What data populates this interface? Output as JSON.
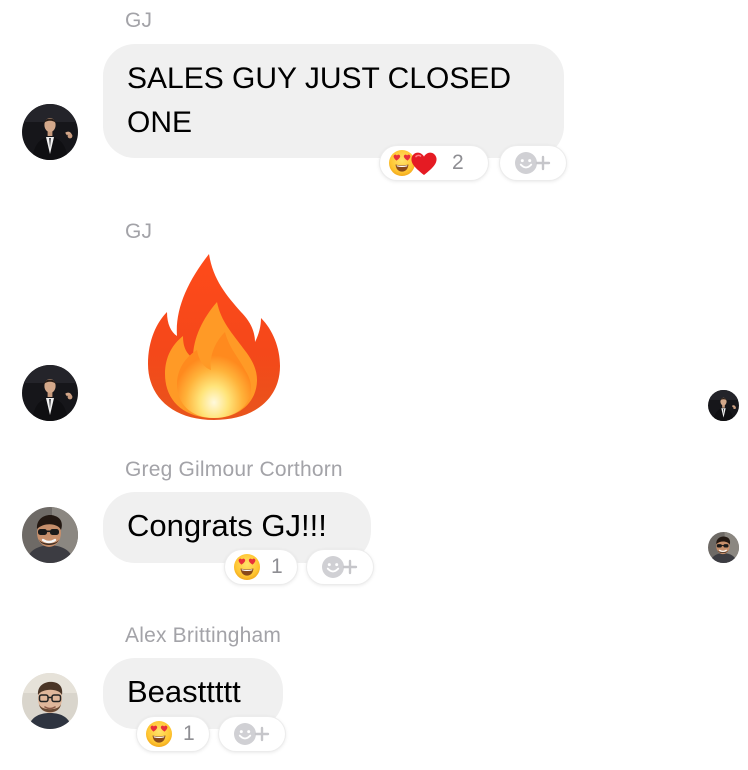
{
  "messages": [
    {
      "sender": "GJ",
      "text": "SALES GUY JUST CLOSED ONE",
      "reactions": [
        "heart-eyes",
        "heart"
      ],
      "reaction_count": "2"
    },
    {
      "sender": "GJ",
      "emoji": "fire"
    },
    {
      "sender": "Greg Gilmour Corthorn",
      "text": "Congrats GJ!!!",
      "reactions": [
        "heart-eyes"
      ],
      "reaction_count": "1"
    },
    {
      "sender": "Alex Brittingham",
      "text": "Beasttttt",
      "reactions": [
        "heart-eyes"
      ],
      "reaction_count": "1"
    }
  ],
  "icons": {
    "add_reaction": "add-reaction-icon",
    "heart_eyes": "heart-eyes-emoji",
    "heart": "red-heart-emoji",
    "fire": "fire-emoji"
  },
  "colors": {
    "bubble": "#f0f0f0",
    "sender_name": "#a3a3a8",
    "count_text": "#8e8e93"
  }
}
